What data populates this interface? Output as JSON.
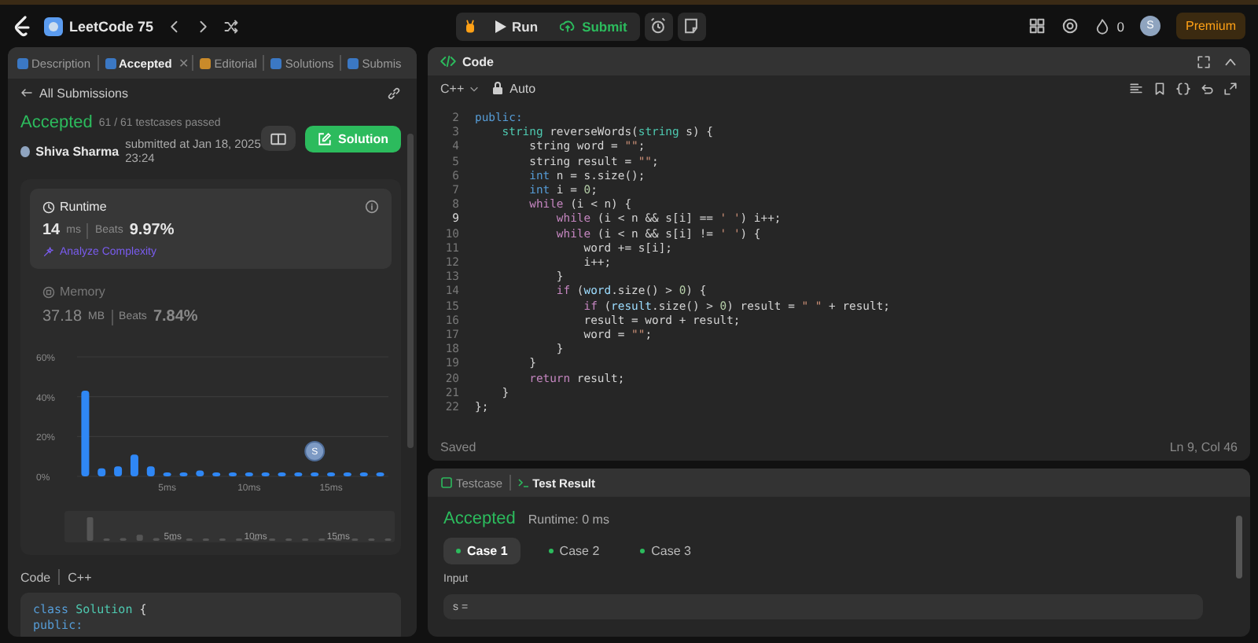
{
  "top_bar": {
    "title": "LeetCode 75",
    "run_label": "Run",
    "submit_label": "Submit",
    "streak": "0",
    "avatar": "S",
    "premium": "Premium"
  },
  "left_tabs": [
    {
      "label": "Description",
      "selected": false
    },
    {
      "label": "Accepted",
      "selected": true,
      "close": "✕"
    },
    {
      "label": "Editorial",
      "selected": false
    },
    {
      "label": "Solutions",
      "selected": false
    },
    {
      "label": "Submis",
      "selected": false
    }
  ],
  "back_link": "All Submissions",
  "submission": {
    "status": "Accepted",
    "testcases": "61 / 61 testcases passed",
    "author": "Shiva Sharma",
    "submitted": "submitted at Jan 18, 2025 23:24",
    "solution_button": "Solution"
  },
  "runtime": {
    "title": "Runtime",
    "value": "14",
    "unit": "ms",
    "beats_label": "Beats",
    "beats": "9.97%",
    "analyze": "Analyze Complexity"
  },
  "memory": {
    "title": "Memory",
    "value": "37.18",
    "unit": "MB",
    "beats_label": "Beats",
    "beats": "7.84%"
  },
  "runtime_chart": {
    "chart_data": {
      "type": "bar",
      "x": [
        0,
        1,
        2,
        3,
        4,
        5,
        6,
        7,
        8,
        9,
        10,
        11,
        12,
        13,
        14,
        15,
        16,
        17,
        18
      ],
      "series": [
        {
          "color": "#2f87f5",
          "values": [
            43,
            4,
            5,
            11,
            5,
            1,
            1,
            3,
            1,
            1,
            1,
            1,
            1,
            1,
            1,
            1,
            1,
            1,
            1
          ]
        }
      ],
      "xlim": [
        -0.5,
        18.5
      ],
      "ylim": [
        0,
        60
      ],
      "yticks": [
        {
          "value": 0,
          "label": "0%"
        },
        {
          "value": 20,
          "label": "20%"
        },
        {
          "value": 40,
          "label": "40%"
        },
        {
          "value": 60,
          "label": "60%"
        }
      ],
      "xticks": [
        {
          "value": 5,
          "label": "5ms"
        },
        {
          "value": 10,
          "label": "10ms"
        },
        {
          "value": 15,
          "label": "15ms"
        }
      ],
      "annotations": [
        {
          "x": 14,
          "text": "S"
        }
      ]
    }
  },
  "overview": {
    "labels": [
      "5ms",
      "10ms",
      "15ms"
    ]
  },
  "code_preview": {
    "label": "Code",
    "language": "C++",
    "lines": [
      [
        {
          "kind": "builtin",
          "text": "class"
        },
        {
          "kind": "type",
          "text": " Solution"
        },
        {
          "kind": "plain",
          "text": " {"
        }
      ],
      [
        {
          "kind": "builtin",
          "text": "public:"
        }
      ]
    ]
  },
  "editor": {
    "title": "Code",
    "language": "C++",
    "mode": "Auto",
    "status": "Saved",
    "cursor": "Ln 9, Col 46",
    "lines": [
      {
        "number": "2",
        "active": false,
        "tokens": [
          {
            "kind": "builtin",
            "text": "public:"
          }
        ]
      },
      {
        "number": "3",
        "active": false,
        "tokens": [
          {
            "kind": "type",
            "text": "    string"
          },
          {
            "kind": "plain",
            "text": " reverseWords("
          },
          {
            "kind": "type",
            "text": "string"
          },
          {
            "kind": "plain",
            "text": " s) {"
          }
        ]
      },
      {
        "number": "4",
        "active": false,
        "tokens": [
          {
            "kind": "plain",
            "text": "        string word = "
          },
          {
            "kind": "string",
            "text": "\"\""
          },
          {
            "kind": "plain",
            "text": ";"
          }
        ]
      },
      {
        "number": "5",
        "active": false,
        "tokens": [
          {
            "kind": "plain",
            "text": "        string result = "
          },
          {
            "kind": "string",
            "text": "\"\""
          },
          {
            "kind": "plain",
            "text": ";"
          }
        ]
      },
      {
        "number": "6",
        "active": false,
        "tokens": [
          {
            "kind": "builtin",
            "text": "        int"
          },
          {
            "kind": "plain",
            "text": " n = s.size();"
          }
        ]
      },
      {
        "number": "7",
        "active": false,
        "tokens": [
          {
            "kind": "builtin",
            "text": "        int"
          },
          {
            "kind": "plain",
            "text": " i = "
          },
          {
            "kind": "number",
            "text": "0"
          },
          {
            "kind": "plain",
            "text": ";"
          }
        ]
      },
      {
        "number": "8",
        "active": false,
        "tokens": [
          {
            "kind": "keyword",
            "text": "        while"
          },
          {
            "kind": "plain",
            "text": " (i < n) {"
          }
        ]
      },
      {
        "number": "9",
        "active": true,
        "tokens": [
          {
            "kind": "keyword",
            "text": "            while"
          },
          {
            "kind": "plain",
            "text": " (i < n && s[i] == "
          },
          {
            "kind": "string",
            "text": "' '"
          },
          {
            "kind": "plain",
            "text": ") i++;"
          }
        ]
      },
      {
        "number": "10",
        "active": false,
        "tokens": [
          {
            "kind": "keyword",
            "text": "            while"
          },
          {
            "kind": "plain",
            "text": " (i < n && s[i] != "
          },
          {
            "kind": "string",
            "text": "' '"
          },
          {
            "kind": "plain",
            "text": ") {"
          }
        ]
      },
      {
        "number": "11",
        "active": false,
        "tokens": [
          {
            "kind": "plain",
            "text": "                word += s[i];"
          }
        ]
      },
      {
        "number": "12",
        "active": false,
        "tokens": [
          {
            "kind": "plain",
            "text": "                i++;"
          }
        ]
      },
      {
        "number": "13",
        "active": false,
        "tokens": [
          {
            "kind": "plain",
            "text": "            }"
          }
        ]
      },
      {
        "number": "14",
        "active": false,
        "tokens": [
          {
            "kind": "keyword",
            "text": "            if"
          },
          {
            "kind": "plain",
            "text": " ("
          },
          {
            "kind": "member",
            "text": "word"
          },
          {
            "kind": "plain",
            "text": ".size() > "
          },
          {
            "kind": "number",
            "text": "0"
          },
          {
            "kind": "plain",
            "text": ") {"
          }
        ]
      },
      {
        "number": "15",
        "active": false,
        "tokens": [
          {
            "kind": "keyword",
            "text": "                if"
          },
          {
            "kind": "plain",
            "text": " ("
          },
          {
            "kind": "member",
            "text": "result"
          },
          {
            "kind": "plain",
            "text": ".size() > "
          },
          {
            "kind": "number",
            "text": "0"
          },
          {
            "kind": "plain",
            "text": ") result = "
          },
          {
            "kind": "string",
            "text": "\" \""
          },
          {
            "kind": "plain",
            "text": " + result;"
          }
        ]
      },
      {
        "number": "16",
        "active": false,
        "tokens": [
          {
            "kind": "plain",
            "text": "                result = word + result;"
          }
        ]
      },
      {
        "number": "17",
        "active": false,
        "tokens": [
          {
            "kind": "plain",
            "text": "                word = "
          },
          {
            "kind": "string",
            "text": "\"\""
          },
          {
            "kind": "plain",
            "text": ";"
          }
        ]
      },
      {
        "number": "18",
        "active": false,
        "tokens": [
          {
            "kind": "plain",
            "text": "            }"
          }
        ]
      },
      {
        "number": "19",
        "active": false,
        "tokens": [
          {
            "kind": "plain",
            "text": "        }"
          }
        ]
      },
      {
        "number": "20",
        "active": false,
        "tokens": [
          {
            "kind": "keyword",
            "text": "        return"
          },
          {
            "kind": "plain",
            "text": " result;"
          }
        ]
      },
      {
        "number": "21",
        "active": false,
        "tokens": [
          {
            "kind": "plain",
            "text": "    }"
          }
        ]
      },
      {
        "number": "22",
        "active": false,
        "tokens": [
          {
            "kind": "plain",
            "text": "};"
          }
        ]
      }
    ]
  },
  "test_panel": {
    "tabs": [
      {
        "label": "Testcase",
        "selected": false
      },
      {
        "label": "Test Result",
        "selected": true
      }
    ],
    "status": "Accepted",
    "runtime": "Runtime: 0 ms",
    "cases": [
      {
        "label": "Case 1",
        "selected": true,
        "passed": true
      },
      {
        "label": "Case 2",
        "selected": false,
        "passed": true
      },
      {
        "label": "Case 3",
        "selected": false,
        "passed": true
      }
    ],
    "input_label": "Input",
    "input_value": "s ="
  }
}
